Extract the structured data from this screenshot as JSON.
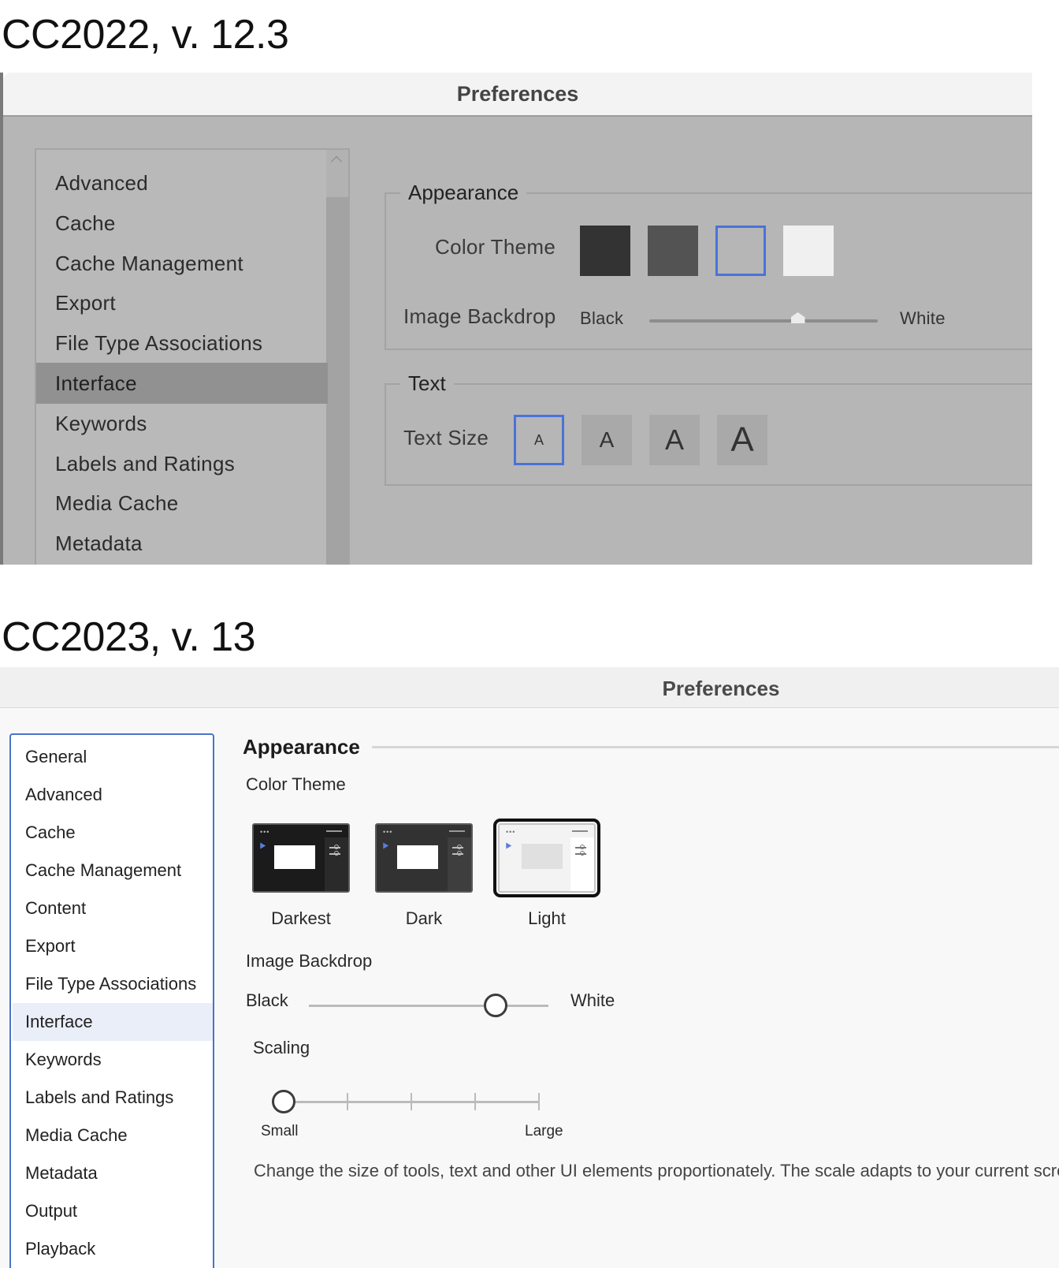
{
  "captions": {
    "old": "CC2022, v. 12.3",
    "new": "CC2023, v. 13"
  },
  "old_window": {
    "title": "Preferences",
    "sidebar_items": [
      "Advanced",
      "Cache",
      "Cache Management",
      "Export",
      "File Type Associations",
      "Interface",
      "Keywords",
      "Labels and Ratings",
      "Media Cache",
      "Metadata"
    ],
    "selected_item": "Interface",
    "appearance": {
      "heading": "Appearance",
      "color_theme_label": "Color Theme",
      "swatches": [
        "#333333",
        "#535353",
        "#b6b6b6",
        "#f0f0f0"
      ],
      "selected_swatch": 2,
      "image_backdrop_label": "Image Backdrop",
      "backdrop_min_label": "Black",
      "backdrop_max_label": "White",
      "backdrop_value": 0.65
    },
    "text": {
      "heading": "Text",
      "text_size_label": "Text Size",
      "sizes": [
        "A",
        "A",
        "A",
        "A"
      ],
      "selected_size": 0
    }
  },
  "new_window": {
    "title": "Preferences",
    "sidebar_items": [
      "General",
      "Advanced",
      "Cache",
      "Cache Management",
      "Content",
      "Export",
      "File Type Associations",
      "Interface",
      "Keywords",
      "Labels and Ratings",
      "Media Cache",
      "Metadata",
      "Output",
      "Playback"
    ],
    "selected_item": "Interface",
    "appearance": {
      "heading": "Appearance",
      "color_theme_label": "Color Theme",
      "themes": [
        {
          "name": "Darkest",
          "bg": "#1b1b1b",
          "border": "#5a5a5a"
        },
        {
          "name": "Dark",
          "bg": "#323232",
          "border": "#5a5a5a"
        },
        {
          "name": "Light",
          "bg": "#f3f3f3",
          "border": "#c6c6c6"
        }
      ],
      "selected_theme": 2,
      "image_backdrop_label": "Image Backdrop",
      "backdrop_min_label": "Black",
      "backdrop_max_label": "White",
      "backdrop_value": 0.78,
      "scaling_label": "Scaling",
      "scaling_min_label": "Small",
      "scaling_max_label": "Large",
      "scaling_value": 0,
      "scaling_description": "Change the size of tools, text and other UI elements proportionately. The scale adapts to your current screen."
    }
  }
}
